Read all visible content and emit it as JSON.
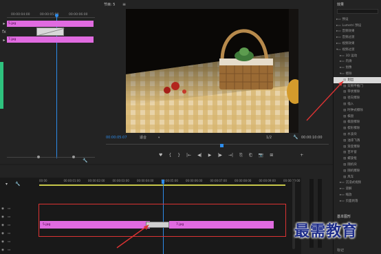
{
  "source_monitor": {
    "timecodes": [
      "00:00:04:00",
      "00:00:05:00",
      "00:00:06:00"
    ],
    "clips": [
      "5.jpg",
      "7.jpg"
    ]
  },
  "program_monitor": {
    "title": "节目: 5",
    "current_time": "00:00:05:07",
    "fit": "适合",
    "resolution": "1/2",
    "duration": "00:00:10:00",
    "transport": [
      "♥",
      "{",
      "}",
      "|←",
      "◀|",
      "▶",
      "|▶",
      "→|",
      "⎘",
      "⎗",
      "📷",
      "⊞",
      "+"
    ]
  },
  "effects_panel": {
    "title": "效果",
    "items": [
      {
        "label": "预设",
        "depth": 1,
        "type": "folder"
      },
      {
        "label": "Lumetri 预设",
        "depth": 1,
        "type": "folder"
      },
      {
        "label": "音频效果",
        "depth": 1,
        "type": "folder"
      },
      {
        "label": "音频过渡",
        "depth": 1,
        "type": "folder"
      },
      {
        "label": "视频效果",
        "depth": 1,
        "type": "folder"
      },
      {
        "label": "视频过渡",
        "depth": 1,
        "type": "folder-open"
      },
      {
        "label": "3D 运动",
        "depth": 2,
        "type": "folder"
      },
      {
        "label": "内滑",
        "depth": 2,
        "type": "folder"
      },
      {
        "label": "划像",
        "depth": 2,
        "type": "folder"
      },
      {
        "label": "擦除",
        "depth": 2,
        "type": "folder-open"
      },
      {
        "label": "划出",
        "depth": 3,
        "type": "item",
        "selected": true
      },
      {
        "label": "双侧平推门",
        "depth": 3,
        "type": "item"
      },
      {
        "label": "带状擦除",
        "depth": 3,
        "type": "item"
      },
      {
        "label": "径向擦除",
        "depth": 3,
        "type": "item"
      },
      {
        "label": "插入",
        "depth": 3,
        "type": "item"
      },
      {
        "label": "时钟式擦除",
        "depth": 3,
        "type": "item"
      },
      {
        "label": "棋盘",
        "depth": 3,
        "type": "item"
      },
      {
        "label": "棋盘擦除",
        "depth": 3,
        "type": "item"
      },
      {
        "label": "楔形擦除",
        "depth": 3,
        "type": "item"
      },
      {
        "label": "水波块",
        "depth": 3,
        "type": "item"
      },
      {
        "label": "油漆飞溅",
        "depth": 3,
        "type": "item"
      },
      {
        "label": "渐变擦除",
        "depth": 3,
        "type": "item"
      },
      {
        "label": "百叶窗",
        "depth": 3,
        "type": "item"
      },
      {
        "label": "螺旋框",
        "depth": 3,
        "type": "item"
      },
      {
        "label": "随机块",
        "depth": 3,
        "type": "item"
      },
      {
        "label": "随机擦除",
        "depth": 3,
        "type": "item"
      },
      {
        "label": "风车",
        "depth": 3,
        "type": "item"
      },
      {
        "label": "沉浸式视频",
        "depth": 2,
        "type": "folder"
      },
      {
        "label": "溶解",
        "depth": 2,
        "type": "folder"
      },
      {
        "label": "缩放",
        "depth": 2,
        "type": "folder"
      },
      {
        "label": "页面剥落",
        "depth": 2,
        "type": "folder"
      }
    ],
    "bottom_title": "基本图形",
    "bottom_label": "标记"
  },
  "timeline": {
    "ruler": [
      "00:00",
      "00:00:01:00",
      "00:00:02:00",
      "00:00:03:00",
      "00:00:04:00",
      "00:00:05:00",
      "00:00:06:00",
      "00:00:07:00",
      "00:00:08:00",
      "00:00:09:00",
      "00:00:10:00"
    ],
    "clips": [
      "5.jpg",
      "7.jpg"
    ],
    "track_labels": [
      "V3",
      "V2",
      "V1",
      "A1",
      "A2",
      "A3"
    ]
  },
  "watermark": "最需教育",
  "colors": {
    "clip": "#e06be0",
    "accent": "#2d8ceb",
    "annotation": "#d33"
  }
}
